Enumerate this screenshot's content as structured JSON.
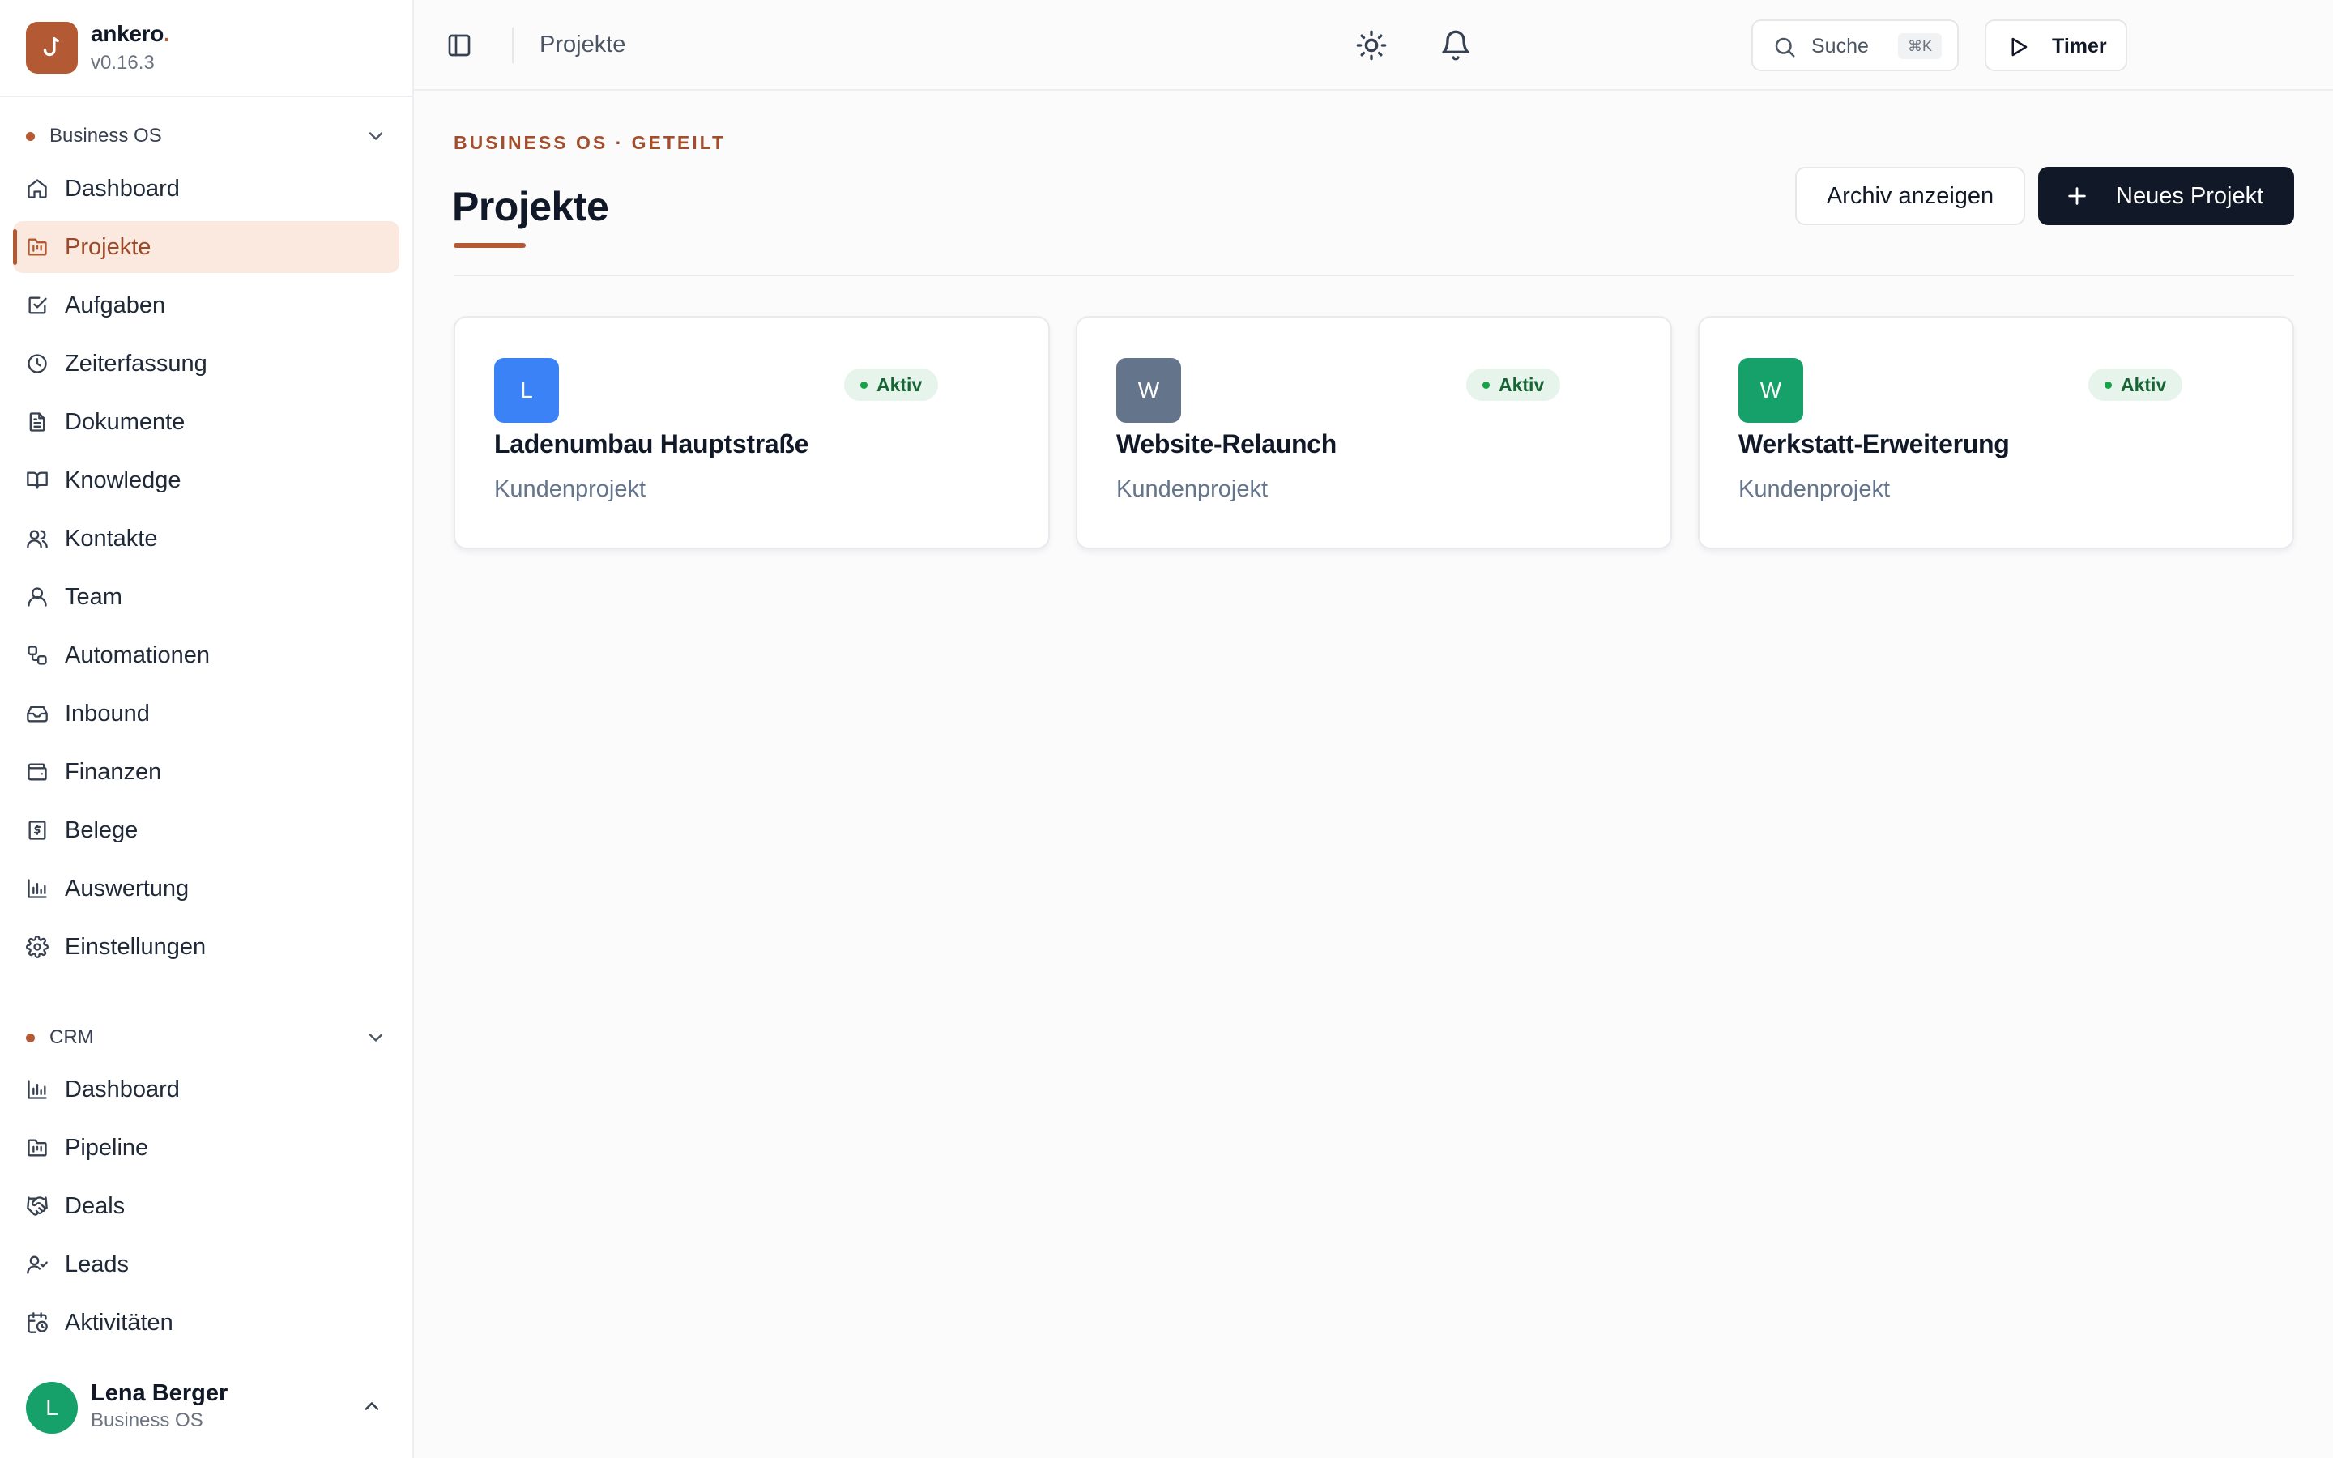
{
  "brand": {
    "name": "ankero",
    "dot": ".",
    "version": "v0.16.3"
  },
  "sidebar": {
    "groups": [
      {
        "label": "Business OS",
        "items": [
          {
            "label": "Dashboard",
            "icon": "home-icon"
          },
          {
            "label": "Projekte",
            "icon": "folder-kanban-icon",
            "active": true
          },
          {
            "label": "Aufgaben",
            "icon": "check-square-icon"
          },
          {
            "label": "Zeiterfassung",
            "icon": "clock-icon"
          },
          {
            "label": "Dokumente",
            "icon": "file-text-icon"
          },
          {
            "label": "Knowledge",
            "icon": "book-open-icon"
          },
          {
            "label": "Kontakte",
            "icon": "users-icon"
          },
          {
            "label": "Team",
            "icon": "user-round-icon"
          },
          {
            "label": "Automationen",
            "icon": "workflow-icon"
          },
          {
            "label": "Inbound",
            "icon": "inbox-icon"
          },
          {
            "label": "Finanzen",
            "icon": "wallet-icon"
          },
          {
            "label": "Belege",
            "icon": "receipt-icon"
          },
          {
            "label": "Auswertung",
            "icon": "bar-chart-icon"
          },
          {
            "label": "Einstellungen",
            "icon": "settings-icon"
          }
        ]
      },
      {
        "label": "CRM",
        "items": [
          {
            "label": "Dashboard",
            "icon": "bar-chart-icon"
          },
          {
            "label": "Pipeline",
            "icon": "folder-kanban-icon"
          },
          {
            "label": "Deals",
            "icon": "handshake-icon"
          },
          {
            "label": "Leads",
            "icon": "user-check-icon"
          },
          {
            "label": "Aktivitäten",
            "icon": "calendar-clock-icon"
          }
        ]
      }
    ]
  },
  "user": {
    "initial": "L",
    "name": "Lena Berger",
    "workspace": "Business OS"
  },
  "topbar": {
    "title": "Projekte",
    "search_label": "Suche",
    "search_shortcut": "⌘K",
    "timer_label": "Timer"
  },
  "page": {
    "eyebrow": "BUSINESS OS · GETEILT",
    "title": "Projekte",
    "archive_label": "Archiv anzeigen",
    "new_label": "Neues Projekt"
  },
  "projects": [
    {
      "initial": "L",
      "name": "Ladenumbau Hauptstraße",
      "type": "Kundenprojekt",
      "status": "Aktiv",
      "color": "#3b82f6"
    },
    {
      "initial": "W",
      "name": "Website-Relaunch",
      "type": "Kundenprojekt",
      "status": "Aktiv",
      "color": "#64748b"
    },
    {
      "initial": "W",
      "name": "Werkstatt-Erweiterung",
      "type": "Kundenprojekt",
      "status": "Aktiv",
      "color": "#16a06a"
    }
  ],
  "colors": {
    "accent": "#b35a34",
    "primary_button": "#111827",
    "active_nav_bg": "#fbe9df",
    "status_green": "#16a34a"
  }
}
